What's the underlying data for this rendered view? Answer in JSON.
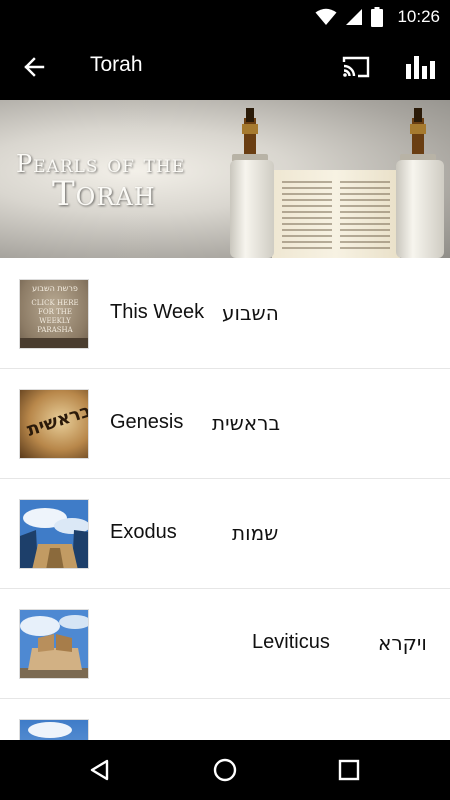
{
  "status_bar": {
    "time": "10:26",
    "icons": [
      "wifi-icon",
      "signal-icon",
      "battery-icon"
    ]
  },
  "app_bar": {
    "title": "Torah",
    "back_icon": "arrow-left-icon",
    "cast_icon": "cast-icon",
    "stats_icon": "bar-chart-icon"
  },
  "banner": {
    "line1": "Pearls of the",
    "line2": "Torah"
  },
  "list": {
    "items": [
      {
        "english": "This Week",
        "hebrew": "השבוע",
        "thumb_text": [
          "פרשת השבוע",
          "CLICK HERE",
          "FOR THE",
          "WEEKLY",
          "PARASHA"
        ]
      },
      {
        "english": "Genesis",
        "hebrew": "בראשית",
        "thumb_text": [
          "בראשית"
        ]
      },
      {
        "english": "Exodus",
        "hebrew": "שמות"
      },
      {
        "english": "Leviticus",
        "hebrew": "ויקרא"
      }
    ]
  },
  "nav_bar": {
    "icons": [
      "back-triangle-icon",
      "home-circle-icon",
      "recents-square-icon"
    ]
  },
  "colors": {
    "bars": "#000000",
    "background": "#ffffff",
    "divider": "#e6e6e6"
  }
}
